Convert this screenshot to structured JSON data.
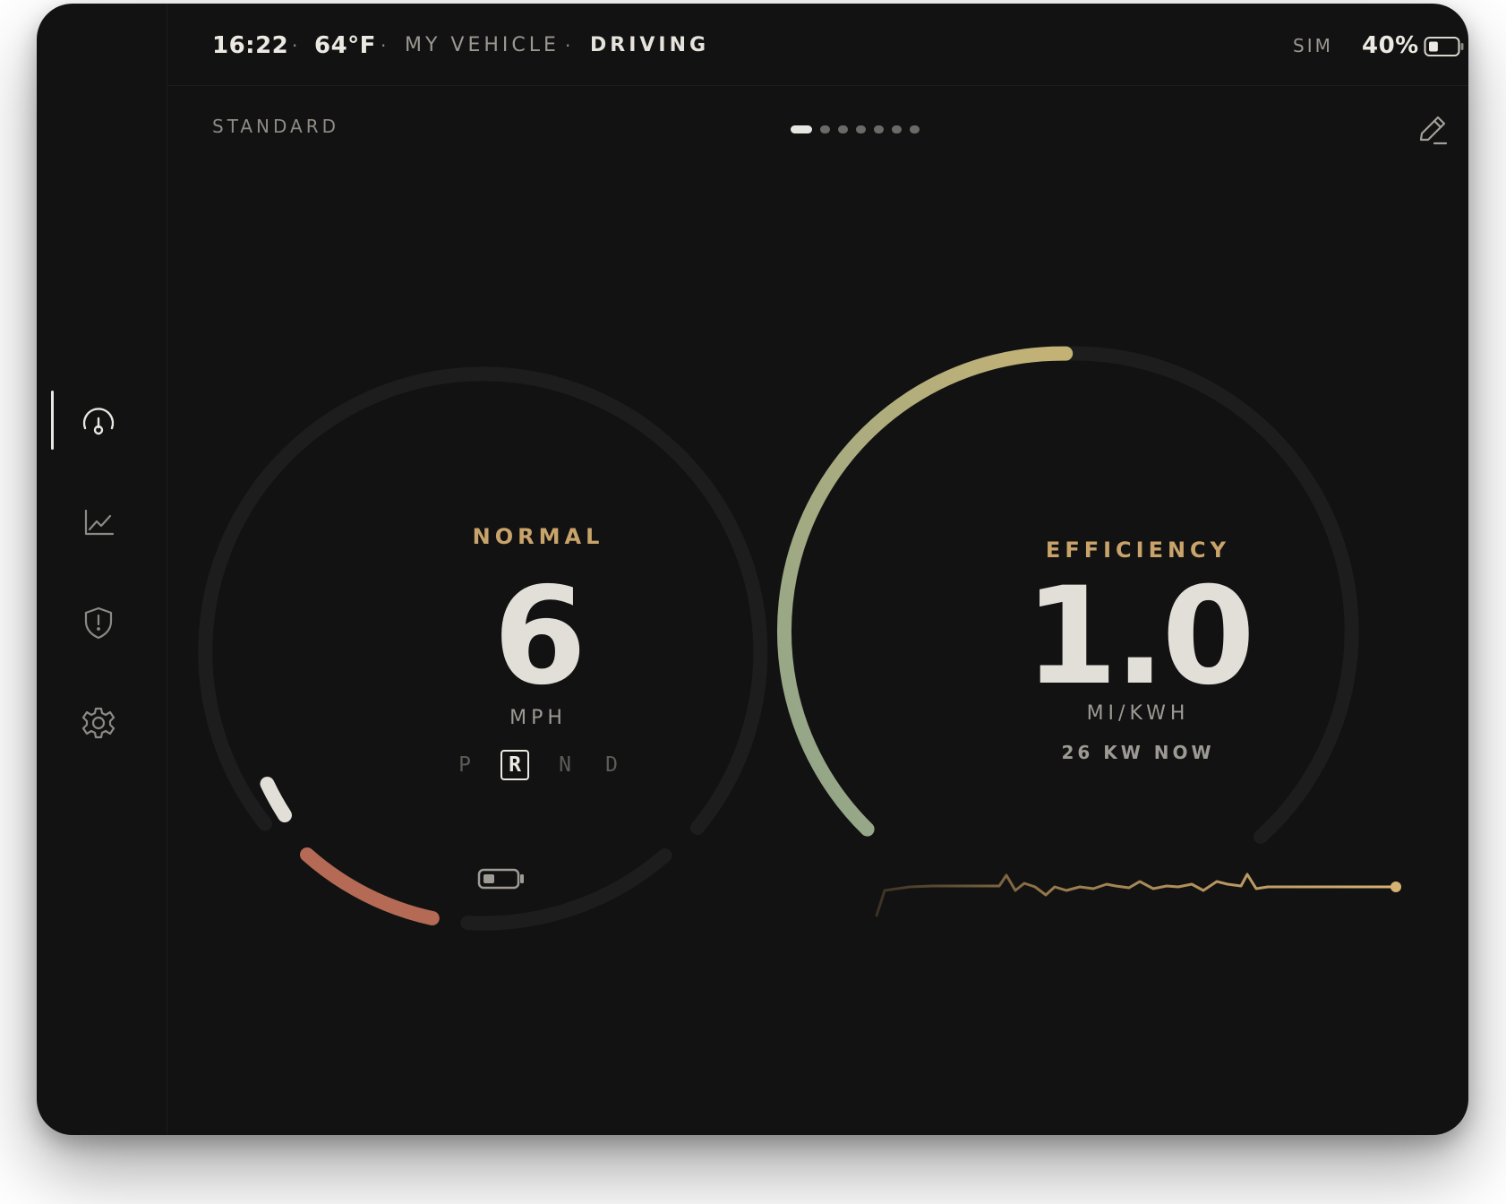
{
  "status_bar": {
    "time": "16:22",
    "temperature": "64°F",
    "vehicle": "MY VEHICLE",
    "state": "DRIVING",
    "separator": "·",
    "mode_tag": "SIM",
    "battery_percent": "40%",
    "battery_level": 0.4
  },
  "sidebar": {
    "items": [
      {
        "name": "dashboard",
        "icon": "gauge-icon",
        "active": true
      },
      {
        "name": "stats",
        "icon": "line-chart-icon",
        "active": false
      },
      {
        "name": "alerts",
        "icon": "shield-alert-icon",
        "active": false
      },
      {
        "name": "settings",
        "icon": "gear-icon",
        "active": false
      }
    ]
  },
  "header": {
    "mode_label": "STANDARD",
    "page_count": 7,
    "active_page": 0,
    "edit_icon": "pencil-icon"
  },
  "speed_gauge": {
    "mode": "NORMAL",
    "value": "6",
    "unit": "MPH",
    "gears": [
      "P",
      "R",
      "N",
      "D"
    ],
    "active_gear": "R",
    "battery_icon": "battery-icon",
    "accent_color": "#c9a46a",
    "regen_color": "#b46a54"
  },
  "efficiency_gauge": {
    "title": "EFFICIENCY",
    "value": "1.0",
    "unit": "MI/KWH",
    "power_readout": "26 KW NOW",
    "arc_color_start": "#8fa58a",
    "arc_color_end": "#c4b275",
    "trace_color": "#c9a46a"
  }
}
